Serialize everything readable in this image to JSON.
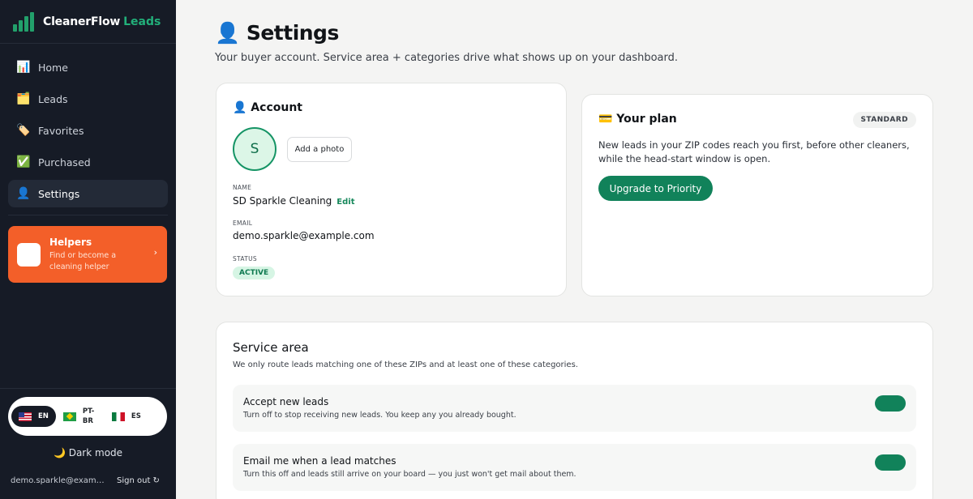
{
  "brand": {
    "name": "CleanerFlow",
    "accent": "Leads"
  },
  "nav": [
    {
      "icon": "📊",
      "icon_name": "chart-icon",
      "label": "Home",
      "active": false
    },
    {
      "icon": "🗂️",
      "icon_name": "folder-icon",
      "label": "Leads",
      "active": false
    },
    {
      "icon": "🏷️",
      "icon_name": "tag-icon",
      "label": "Favorites",
      "active": false
    },
    {
      "icon": "✅",
      "icon_name": "check-icon",
      "label": "Purchased",
      "active": false
    },
    {
      "icon": "👤",
      "icon_name": "user-icon",
      "label": "Settings",
      "active": true
    }
  ],
  "helpers": {
    "title": "Helpers",
    "subtitle": "Find or become a cleaning helper",
    "chevron": "›"
  },
  "languages": [
    {
      "code": "EN",
      "active": true
    },
    {
      "code": "PT-BR",
      "active": false
    },
    {
      "code": "ES",
      "active": false
    }
  ],
  "dark_mode": "🌙 Dark mode",
  "footer": {
    "email": "demo.sparkle@example.com",
    "signout": "Sign out ↻"
  },
  "page": {
    "title": "👤 Settings",
    "subtitle": "Your buyer account. Service area + categories drive what shows up on your dashboard."
  },
  "account": {
    "title": "👤 Account",
    "avatar_initial": "S",
    "add_photo": "Add a photo",
    "name_label": "NAME",
    "name": "SD Sparkle Cleaning",
    "edit": "Edit",
    "email_label": "EMAIL",
    "email": "demo.sparkle@example.com",
    "status_label": "STATUS",
    "status": "ACTIVE"
  },
  "plan": {
    "title": "💳 Your plan",
    "badge": "STANDARD",
    "description": "New leads in your ZIP codes reach you first, before other cleaners, while the head-start window is open.",
    "upgrade": "Upgrade to Priority"
  },
  "service_area": {
    "title": "Service area",
    "subtitle": "We only route leads matching one of these ZIPs and at least one of these categories.",
    "toggles": [
      {
        "title": "Accept new leads",
        "description": "Turn off to stop receiving new leads. You keep any you already bought.",
        "on": true
      },
      {
        "title": "Email me when a lead matches",
        "description": "Turn this off and leads still arrive on your board — you just won't get mail about them.",
        "on": true
      }
    ]
  },
  "colors": {
    "sidebar": "#161b26",
    "accent_green": "#11825a",
    "helpers_orange": "#f35f29",
    "background": "#f4f4f3"
  }
}
